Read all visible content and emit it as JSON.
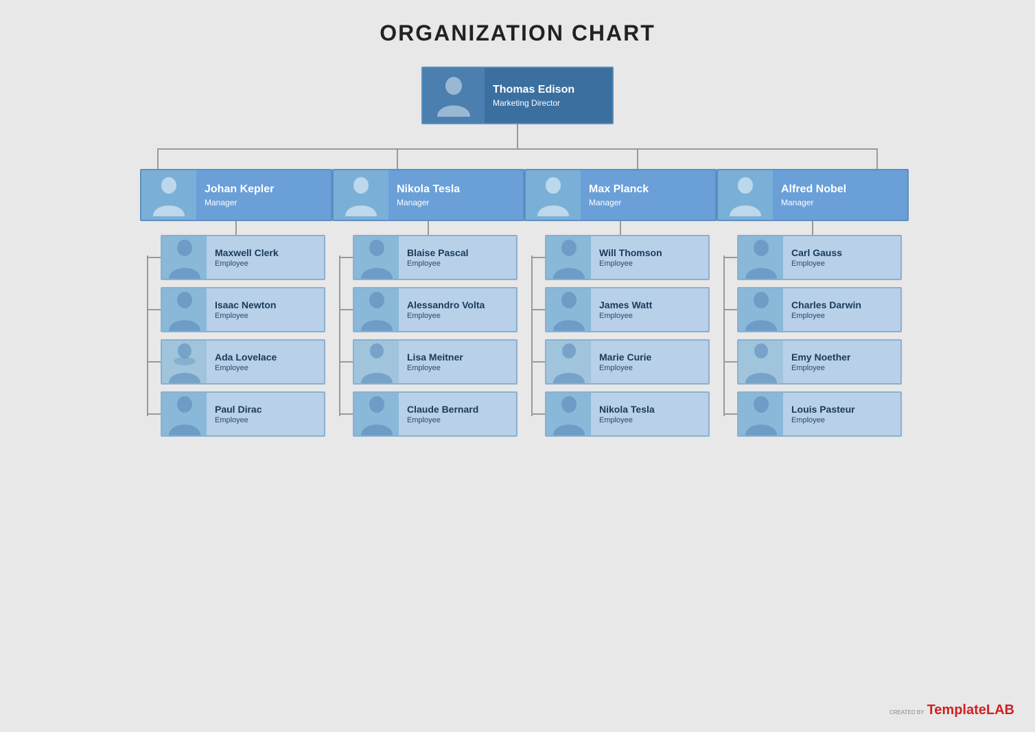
{
  "title": "ORGANIZATION CHART",
  "root": {
    "name": "Thomas Edison",
    "role": "Marketing Director",
    "gender": "male"
  },
  "managers": [
    {
      "name": "Johan Kepler",
      "role": "Manager",
      "gender": "female"
    },
    {
      "name": "Nikola Tesla",
      "role": "Manager",
      "gender": "male"
    },
    {
      "name": "Max Planck",
      "role": "Manager",
      "gender": "male"
    },
    {
      "name": "Alfred Nobel",
      "role": "Manager",
      "gender": "male"
    }
  ],
  "employees": [
    [
      {
        "name": "Maxwell Clerk",
        "role": "Employee",
        "gender": "male"
      },
      {
        "name": "Isaac Newton",
        "role": "Employee",
        "gender": "male"
      },
      {
        "name": "Ada Lovelace",
        "role": "Employee",
        "gender": "female"
      },
      {
        "name": "Paul Dirac",
        "role": "Employee",
        "gender": "male"
      }
    ],
    [
      {
        "name": "Blaise Pascal",
        "role": "Employee",
        "gender": "male"
      },
      {
        "name": "Alessandro Volta",
        "role": "Employee",
        "gender": "male"
      },
      {
        "name": "Lisa Meitner",
        "role": "Employee",
        "gender": "female"
      },
      {
        "name": "Claude Bernard",
        "role": "Employee",
        "gender": "male"
      }
    ],
    [
      {
        "name": "Will Thomson",
        "role": "Employee",
        "gender": "male"
      },
      {
        "name": "James Watt",
        "role": "Employee",
        "gender": "male"
      },
      {
        "name": "Marie Curie",
        "role": "Employee",
        "gender": "female"
      },
      {
        "name": "Nikola Tesla",
        "role": "Employee",
        "gender": "male"
      }
    ],
    [
      {
        "name": "Carl Gauss",
        "role": "Employee",
        "gender": "male"
      },
      {
        "name": "Charles Darwin",
        "role": "Employee",
        "gender": "male"
      },
      {
        "name": "Emy Noether",
        "role": "Employee",
        "gender": "female"
      },
      {
        "name": "Louis Pasteur",
        "role": "Employee",
        "gender": "male"
      }
    ]
  ],
  "watermark": {
    "created_by": "CREATED BY",
    "brand_plain": "Template",
    "brand_colored": "LAB"
  }
}
